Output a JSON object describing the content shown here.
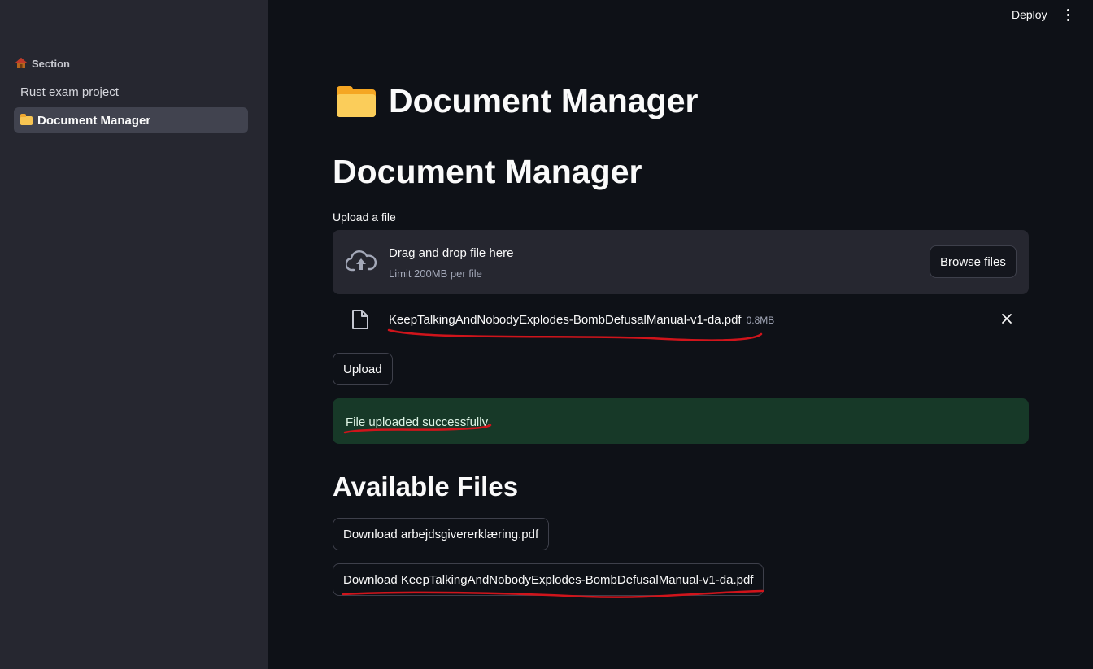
{
  "sidebar": {
    "section_label": "Section",
    "items": [
      {
        "label": "Rust exam project"
      },
      {
        "label": "Document Manager"
      }
    ]
  },
  "header": {
    "deploy_label": "Deploy"
  },
  "main": {
    "page_title": "Document Manager",
    "heading": "Document Manager",
    "uploader": {
      "label": "Upload a file",
      "drop_text": "Drag and drop file here",
      "limit_text": "Limit 200MB per file",
      "browse_label": "Browse files",
      "file": {
        "name": "KeepTalkingAndNobodyExplodes-BombDefusalManual-v1-da.pdf",
        "size": "0.8MB"
      }
    },
    "upload_button": "Upload",
    "success_message": "File uploaded successfully.",
    "available_heading": "Available Files",
    "downloads": [
      {
        "label": "Download arbejdsgivererklæring.pdf"
      },
      {
        "label": "Download KeepTalkingAndNobodyExplodes-BombDefusalManual-v1-da.pdf"
      }
    ]
  },
  "annotation_color": "#d0141b"
}
